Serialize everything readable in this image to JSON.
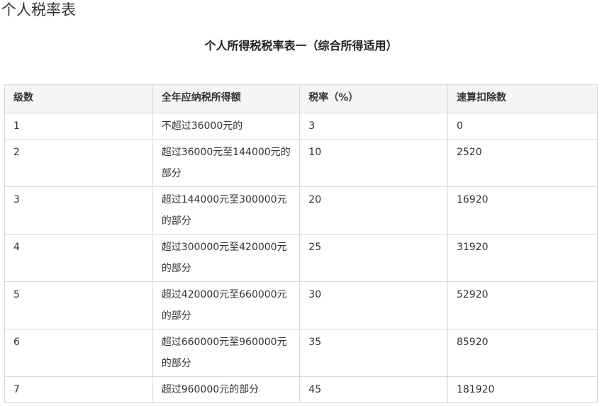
{
  "page": {
    "heading": "个人税率表",
    "table_title": "个人所得税税率表一（综合所得适用）"
  },
  "table": {
    "headers": [
      "级数",
      "全年应纳税所得额",
      "税率（%）",
      "速算扣除数"
    ],
    "rows": [
      {
        "level": "1",
        "range": "不超过36000元的",
        "rate": "3",
        "deduction": "0"
      },
      {
        "level": "2",
        "range": "超过36000元至144000元的部分",
        "rate": "10",
        "deduction": "2520"
      },
      {
        "level": "3",
        "range": "超过144000元至300000元的部分",
        "rate": "20",
        "deduction": "16920"
      },
      {
        "level": "4",
        "range": "超过300000元至420000元的部分",
        "rate": "25",
        "deduction": "31920"
      },
      {
        "level": "5",
        "range": "超过420000元至660000元的部分",
        "rate": "30",
        "deduction": "52920"
      },
      {
        "level": "6",
        "range": "超过660000元至960000元的部分",
        "rate": "35",
        "deduction": "85920"
      },
      {
        "level": "7",
        "range": "超过960000元的部分",
        "rate": "45",
        "deduction": "181920"
      }
    ]
  }
}
